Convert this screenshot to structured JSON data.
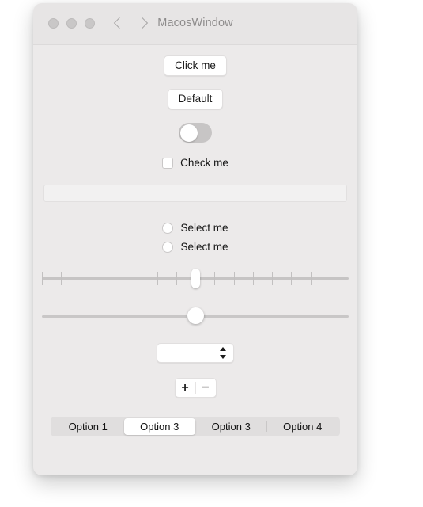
{
  "window": {
    "title": "MacosWindow",
    "traffic_lights": [
      "close-button",
      "minimize-button",
      "maximize-button"
    ],
    "nav": {
      "back": "back-chevron",
      "forward": "forward-chevron"
    }
  },
  "controls": {
    "click_button": {
      "label": "Click me"
    },
    "default_button": {
      "label": "Default"
    },
    "toggle": {
      "state": "off"
    },
    "checkbox": {
      "label": "Check me",
      "checked": false
    },
    "textfield": {
      "value": "",
      "placeholder": ""
    },
    "radios": [
      {
        "label": "Select me",
        "selected": false
      },
      {
        "label": "Select me",
        "selected": false
      }
    ],
    "tick_slider": {
      "value": 50,
      "min": 0,
      "max": 100,
      "ticks": 17
    },
    "plain_slider": {
      "value": 50,
      "min": 0,
      "max": 100
    },
    "stepper": {
      "value": ""
    },
    "plus_minus": {
      "plus_label": "+",
      "minus_label": "−"
    },
    "segmented": {
      "options": [
        "Option 1",
        "Option 3",
        "Option 3",
        "Option 4"
      ],
      "selected_index": 1
    }
  },
  "colors": {
    "window_body": "#eceaea",
    "titlebar": "#e7e5e5",
    "title_text": "#8e8c8c",
    "control_white": "#ffffff",
    "track_gray": "#c7c5c5",
    "segment_bg": "#e0dede"
  }
}
